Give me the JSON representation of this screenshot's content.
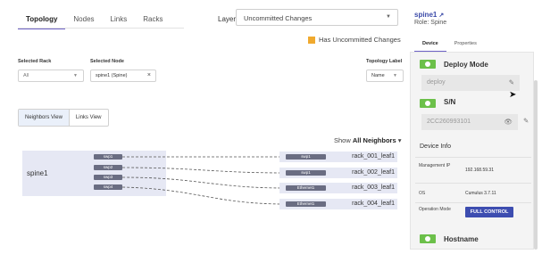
{
  "tabs": [
    {
      "label": "Topology",
      "active": true
    },
    {
      "label": "Nodes",
      "active": false
    },
    {
      "label": "Links",
      "active": false
    },
    {
      "label": "Racks",
      "active": false
    }
  ],
  "layer": {
    "label": "Layer",
    "value": "Uncommitted Changes"
  },
  "uncommitted_label": "Has Uncommitted Changes",
  "filters": {
    "selected_rack_label": "Selected Rack",
    "selected_rack_value": "All",
    "selected_node_label": "Selected Node",
    "selected_node_value": "spine1 (Spine)",
    "topology_label_label": "Topology Label",
    "topology_label_value": "Name"
  },
  "views": {
    "neighbors": "Neighbors View",
    "links": "Links View"
  },
  "show_neighbors": {
    "prefix": "Show",
    "value": "All Neighbors"
  },
  "topology": {
    "node": "spine1",
    "ports": [
      "swp1",
      "swp2",
      "swp3",
      "swp4"
    ],
    "neighbors": [
      {
        "port": "swp1",
        "name": "rack_001_leaf1"
      },
      {
        "port": "swp1",
        "name": "rack_002_leaf1"
      },
      {
        "port": "Ethernet1",
        "name": "rack_003_leaf1"
      },
      {
        "port": "Ethernet1",
        "name": "rack_004_leaf1"
      }
    ]
  },
  "right_panel": {
    "title": "spine1",
    "role": "Role: Spine",
    "tabs": [
      {
        "label": "Device",
        "active": true
      },
      {
        "label": "Properties",
        "active": false
      }
    ],
    "deploy_mode": {
      "title": "Deploy Mode",
      "value": "deploy"
    },
    "sn": {
      "title": "S/N",
      "value": "2CC260993101"
    },
    "device_info": {
      "title": "Device Info",
      "rows": [
        {
          "key": "Management IP",
          "value": "192.168.59.31"
        },
        {
          "key": "OS",
          "value": "Cumulus 3.7.11"
        },
        {
          "key": "Operation Mode",
          "value": "FULL CONTROL"
        }
      ]
    },
    "hostname": {
      "title": "Hostname"
    }
  },
  "colors": {
    "accent": "#6e62c6",
    "uncommitted": "#f0a92e",
    "ok": "#6cc04a",
    "primary_button": "#3d4db0",
    "topo_bg": "#e6e8f4"
  }
}
